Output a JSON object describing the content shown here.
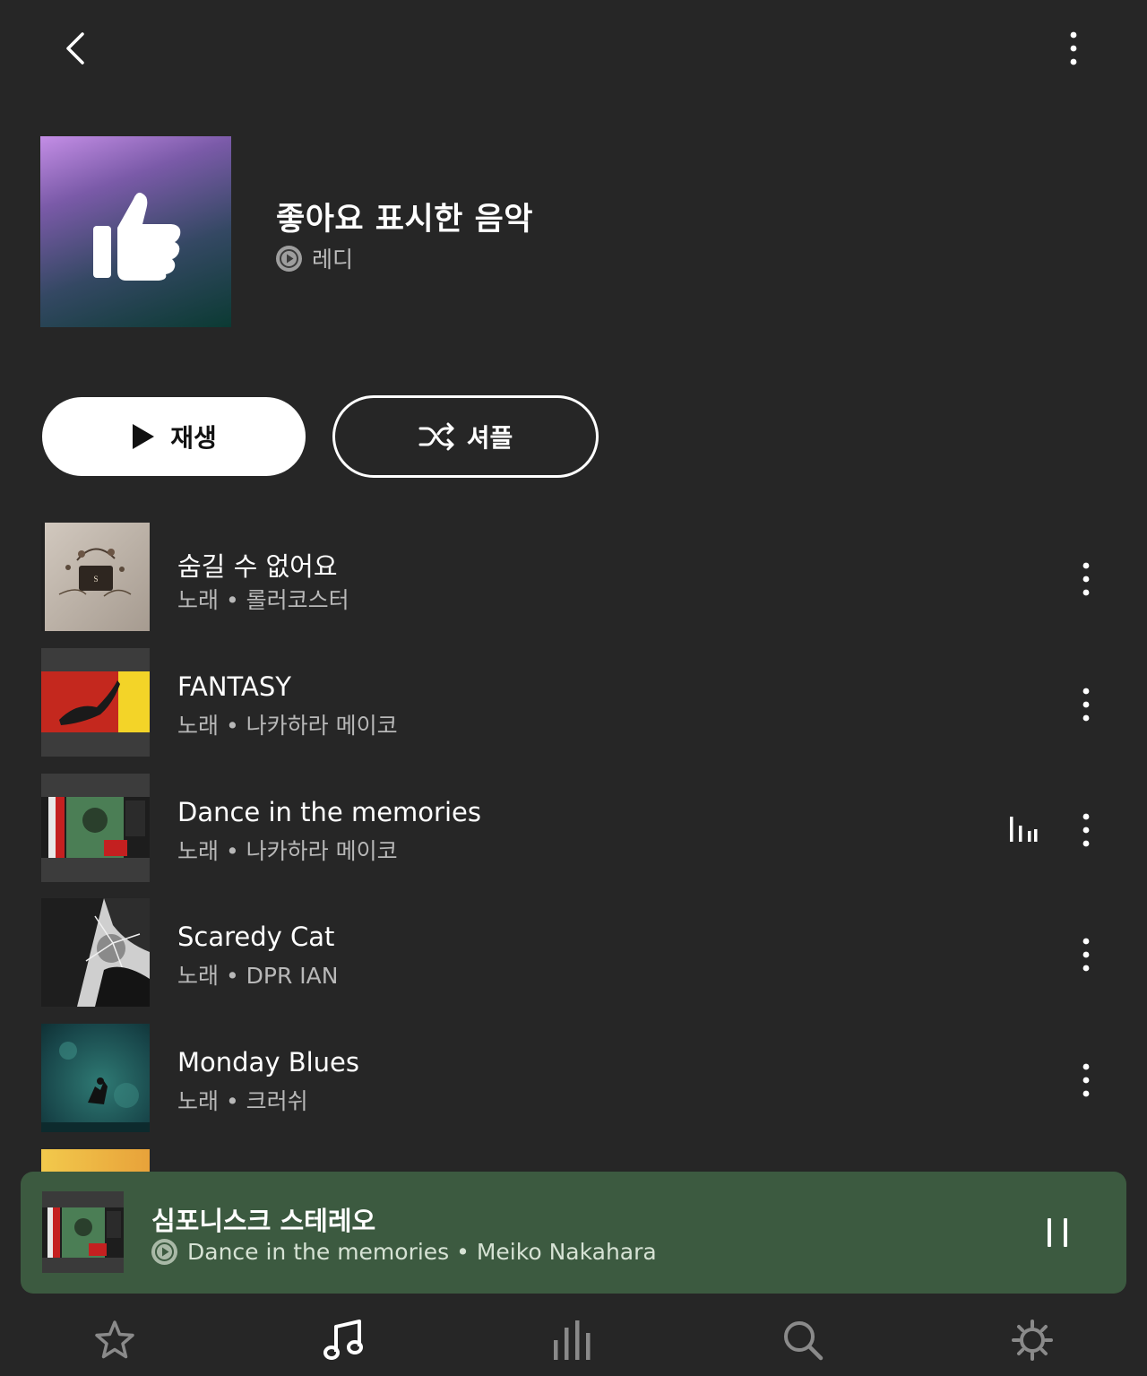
{
  "playlist": {
    "title": "좋아요 표시한 음악",
    "owner": "레디"
  },
  "actions": {
    "play_label": "재생",
    "shuffle_label": "셔플"
  },
  "songs": [
    {
      "title": "숨길 수 없어요",
      "subtitle": "노래 • 롤러코스터",
      "playing": false
    },
    {
      "title": "FANTASY",
      "subtitle": "노래 • 나카하라 메이코",
      "playing": false
    },
    {
      "title": "Dance in the memories",
      "subtitle": "노래 • 나카하라 메이코",
      "playing": true
    },
    {
      "title": "Scaredy Cat",
      "subtitle": "노래 • DPR IAN",
      "playing": false
    },
    {
      "title": "Monday Blues",
      "subtitle": "노래 • 크러쉬",
      "playing": false
    }
  ],
  "player": {
    "station": "심포니스크 스테레오",
    "now_playing": "Dance in the memories • Meiko Nakahara"
  },
  "nav": {
    "items": [
      "star-icon",
      "music-note-icon",
      "equalizer-icon",
      "search-icon",
      "settings-gear-icon"
    ],
    "active": "music-note-icon"
  },
  "colors": {
    "background": "#262626",
    "player_bg": "#3c5a40",
    "secondary_text": "#b8b8b8"
  }
}
